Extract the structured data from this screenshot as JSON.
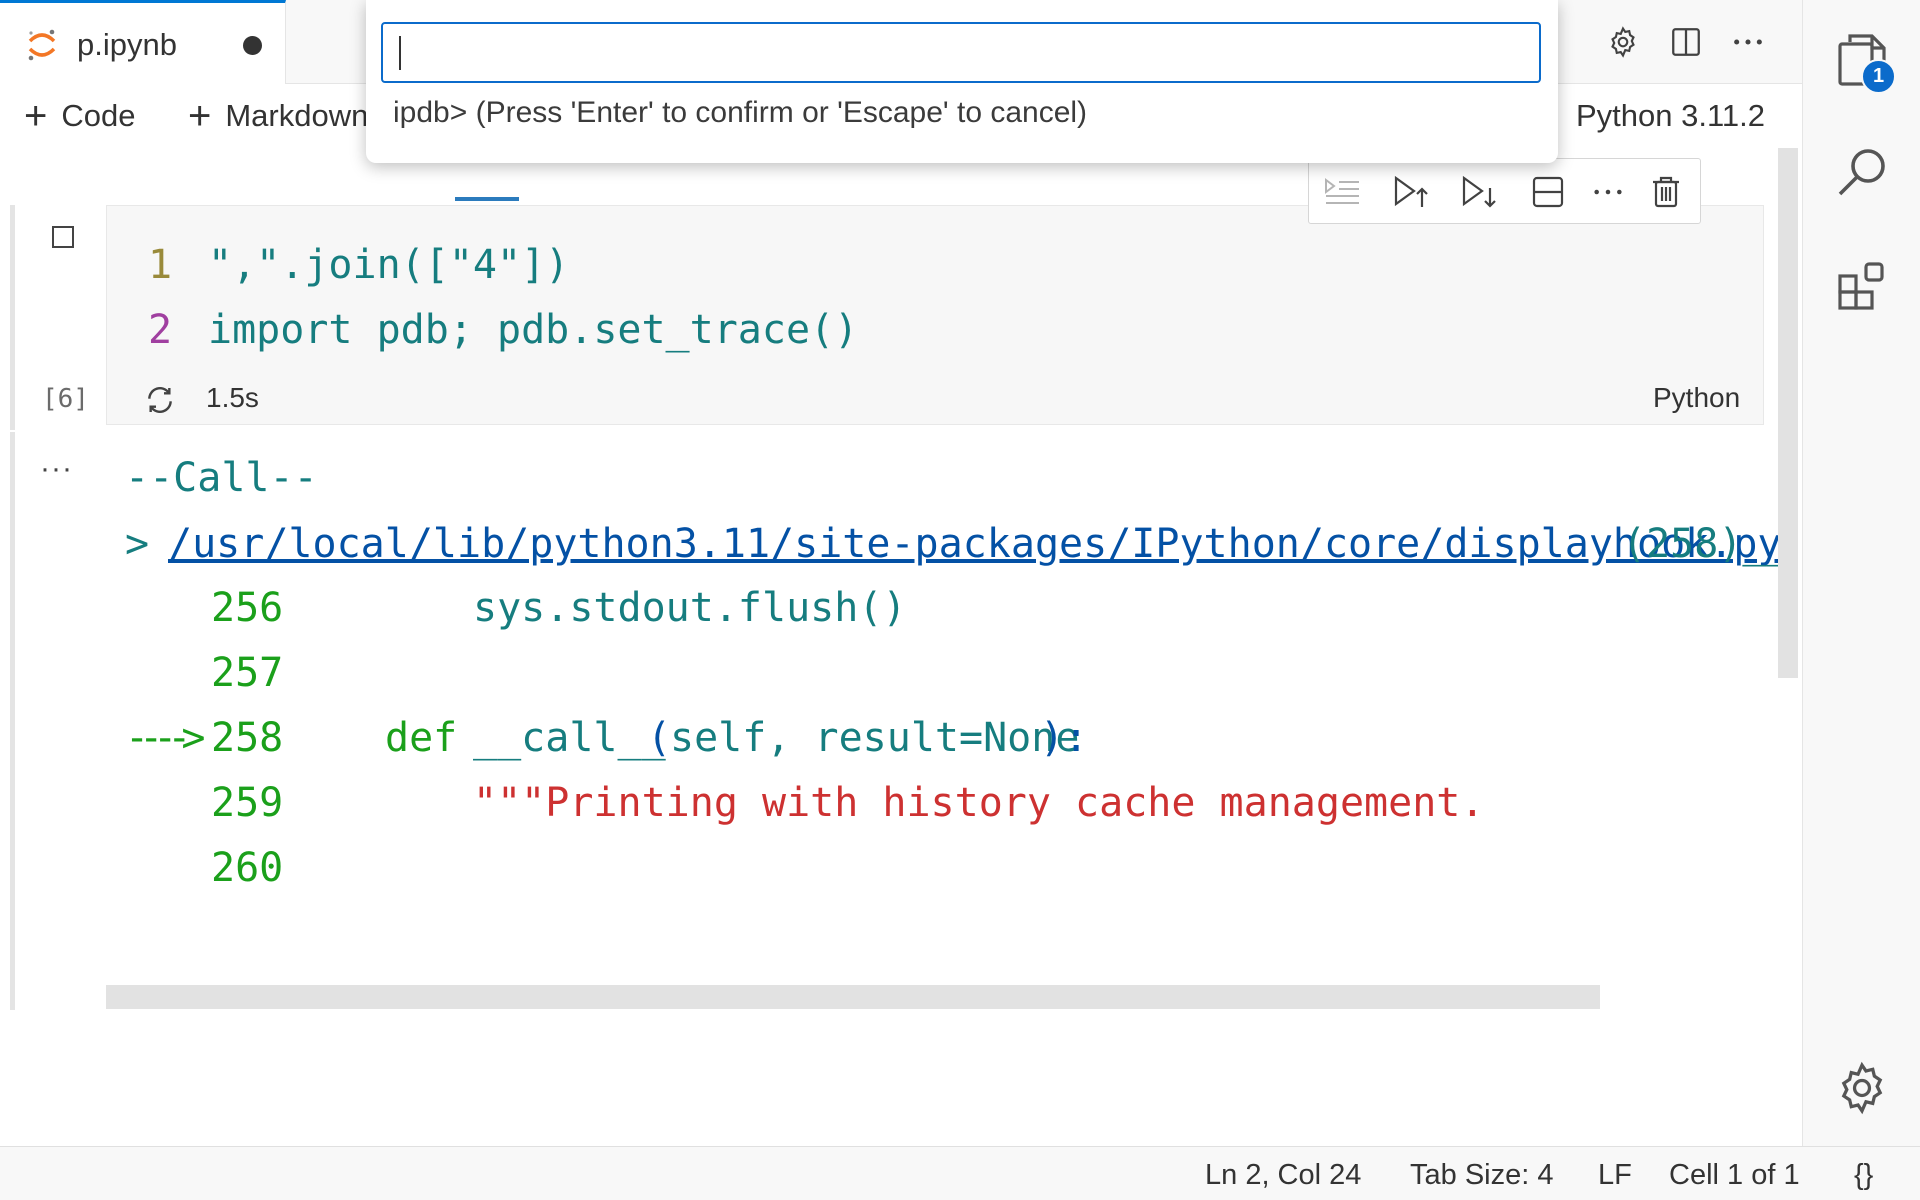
{
  "tab": {
    "filename": "p.ipynb"
  },
  "toolbar": {
    "add_code": "Code",
    "add_markdown": "Markdown",
    "kernel": "Python 3.11.2"
  },
  "palette": {
    "input_value": "",
    "hint": "ipdb> (Press 'Enter' to confirm or 'Escape' to cancel)"
  },
  "cell": {
    "lines": [
      {
        "num": "1",
        "text": "\",\".join([\"4\"])"
      },
      {
        "num": "2",
        "text": "import pdb; pdb.set_trace()"
      }
    ],
    "exec_count": "[6]",
    "exec_time": "1.5s",
    "language": "Python"
  },
  "output": {
    "call": "--Call--",
    "arrow": ">",
    "path": "/usr/local/lib/python3.11/site-packages/IPython/core/displayhook.py",
    "path_suffix": "(258)__",
    "lines": [
      {
        "num": "256",
        "marker": "",
        "code": "sys.stdout.flush()"
      },
      {
        "num": "257",
        "marker": "",
        "code": ""
      },
      {
        "num": "258",
        "marker": "---->",
        "kw": "def",
        "fn": "__call__",
        "paren_open": "(",
        "params": "self, result=None",
        "tail": "):"
      },
      {
        "num": "259",
        "marker": "",
        "code": "\"\"\"Printing with history cache management."
      },
      {
        "num": "260",
        "marker": "",
        "code": ""
      }
    ]
  },
  "activity": {
    "badge": "1"
  },
  "status": {
    "position": "Ln 2, Col 24",
    "tab_size": "Tab Size: 4",
    "eol": "LF",
    "cell": "Cell 1 of 1",
    "braces": "{}"
  },
  "icons": {
    "tab": "jupyter-icon",
    "settings": "gear-icon",
    "split": "split-editor-icon",
    "more": "more-icon",
    "explorer": "files-icon",
    "search": "search-icon",
    "extensions": "extensions-icon",
    "manage": "gear-icon"
  }
}
